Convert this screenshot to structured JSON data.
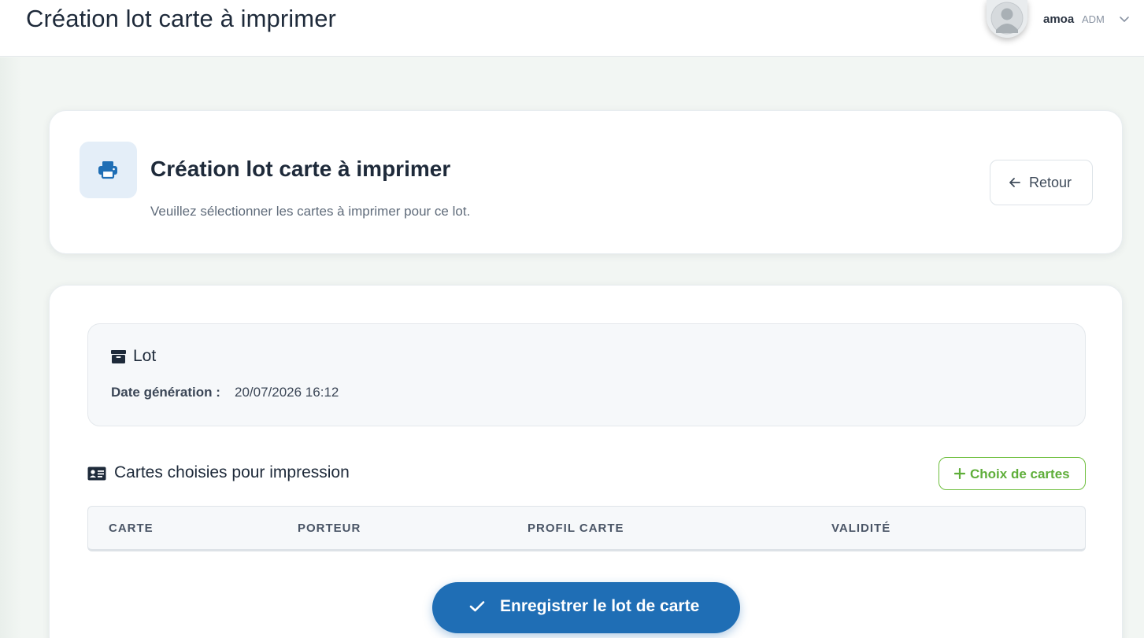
{
  "topbar": {
    "title": "Création lot carte à imprimer",
    "user_name": "amoa",
    "user_role": "ADM",
    "avatar_icon": "user-avatar-icon"
  },
  "header": {
    "title": "Création lot carte à imprimer",
    "subtitle": "Veuillez sélectionner les cartes à imprimer pour ce lot.",
    "icon": "printer-icon",
    "back_label": "Retour"
  },
  "lot": {
    "title": "Lot",
    "date_label": "Date génération :",
    "date_value": "20/07/2026 16:12"
  },
  "cards_section": {
    "title": "Cartes choisies pour impression",
    "choice_button": "Choix de cartes",
    "columns": [
      "CARTE",
      "PORTEUR",
      "PROFIL CARTE",
      "VALIDITÉ"
    ],
    "rows": []
  },
  "save_button": "Enregistrer le lot de carte",
  "colors": {
    "primary": "#1f6eb5",
    "success": "#5fae3a",
    "text_dark": "#1e2a3a",
    "background": "#f2f6f3"
  }
}
